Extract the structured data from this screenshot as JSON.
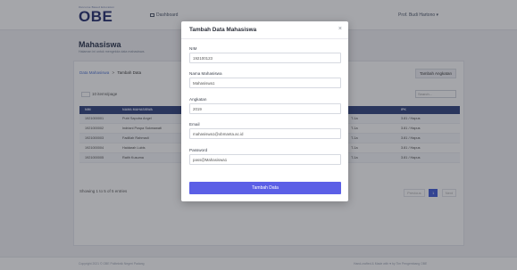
{
  "header": {
    "logo_tagline": "Outcome Based Education",
    "logo": "OBE",
    "nav_dashboard": "Dashboard",
    "user_menu": "Prof. Budi Hartono ▾"
  },
  "page": {
    "title": "Mahasiswa",
    "subtitle": "Halaman ini untuk mengelola data mahasiswa."
  },
  "breadcrumb": {
    "parent": "Data Mahasiswa",
    "separator": ">",
    "current": "Tambah Data"
  },
  "toolbar": {
    "add_angkatan": "Tambah Angkatan",
    "entries": "10",
    "entries_suffix": "items/page",
    "search_placeholder": "Search..."
  },
  "table": {
    "headers": [
      "NIM",
      "NAMA MAHASISWA",
      "",
      "IPK"
    ],
    "rows": [
      {
        "nim": "1921000001",
        "nama": "Putri Saputra Angel",
        "kelas": "T-1a",
        "ipk": "3.81 / Hapus"
      },
      {
        "nim": "1921000002",
        "nama": "Indriani Puspa Sukmawati",
        "kelas": "T-1a",
        "ipk": "3.81 / Hapus"
      },
      {
        "nim": "1921000003",
        "nama": "Fadillah Rahmadi",
        "kelas": "T-1a",
        "ipk": "3.81 / Hapus"
      },
      {
        "nim": "1921000004",
        "nama": "Haidarah Lubis",
        "kelas": "T-1a",
        "ipk": "3.81 / Hapus"
      },
      {
        "nim": "1921000005",
        "nama": "Ratih Kusuma",
        "kelas": "T-1a",
        "ipk": "3.81 / Hapus"
      }
    ],
    "showing": "Showing 1 to 5 of 5 entries",
    "pager": {
      "prev": "Previous",
      "page": "1",
      "next": "Next"
    }
  },
  "footer": {
    "left": "Copyright 2021 © OBE Politeknik Negeri Padang",
    "right": "Hand-crafted & Made with ♥ by Tim Pengembang OBE"
  },
  "modal": {
    "title": "Tambah Data Mahasiswa",
    "close": "×",
    "fields": {
      "nim": {
        "label": "NIM",
        "value": "192100123"
      },
      "nama": {
        "label": "Nama Mahasiswa",
        "value": "Mahasiswa1"
      },
      "angkatan": {
        "label": "Angkatan",
        "value": "2019"
      },
      "email": {
        "label": "Email",
        "value": "mahasiswa1@obmanta.ac.id"
      },
      "password": {
        "label": "Password",
        "value": "pass@Mahasiswa1"
      }
    },
    "submit": "Tambah Data"
  },
  "colors": {
    "accent": "#5b5fe6",
    "table_header": "#2c3f7a",
    "brand": "#1f2a6b"
  }
}
